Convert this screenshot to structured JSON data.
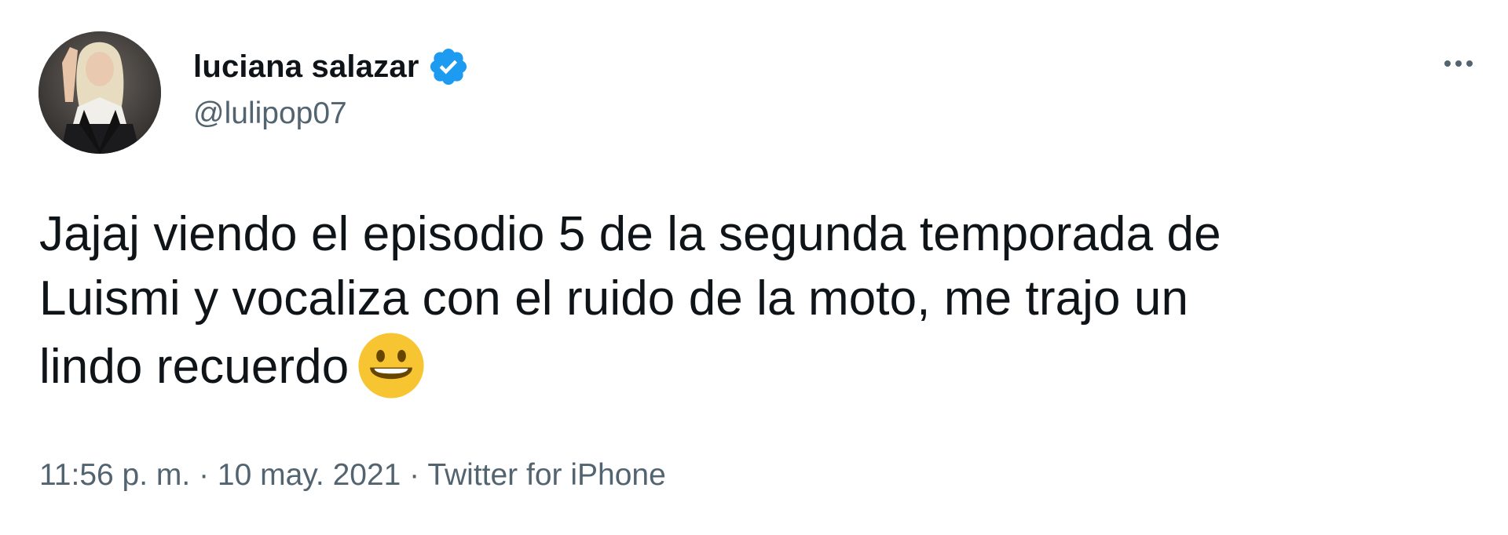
{
  "author": {
    "name": "luciana salazar",
    "handle": "@lulipop07",
    "verified": true,
    "avatar_icon": "profile-photo",
    "verified_icon": "verified-badge-icon"
  },
  "more_icon": "more-dots-icon",
  "tweet": {
    "lines": [
      "Jajaj viendo el episodio 5 de la segunda temporada de",
      "Luismi y vocaliza con el ruido de la moto, me trajo un",
      "lindo recuerdo"
    ],
    "emoji": "grinning-face-emoji"
  },
  "meta": {
    "time": "11:56 p. m.",
    "separator": " · ",
    "date": "10 may. 2021",
    "source": "Twitter for iPhone"
  },
  "colors": {
    "text": "#0f1419",
    "secondary": "#536471",
    "verified": "#1d9bf0",
    "emoji": "#f7c531"
  }
}
